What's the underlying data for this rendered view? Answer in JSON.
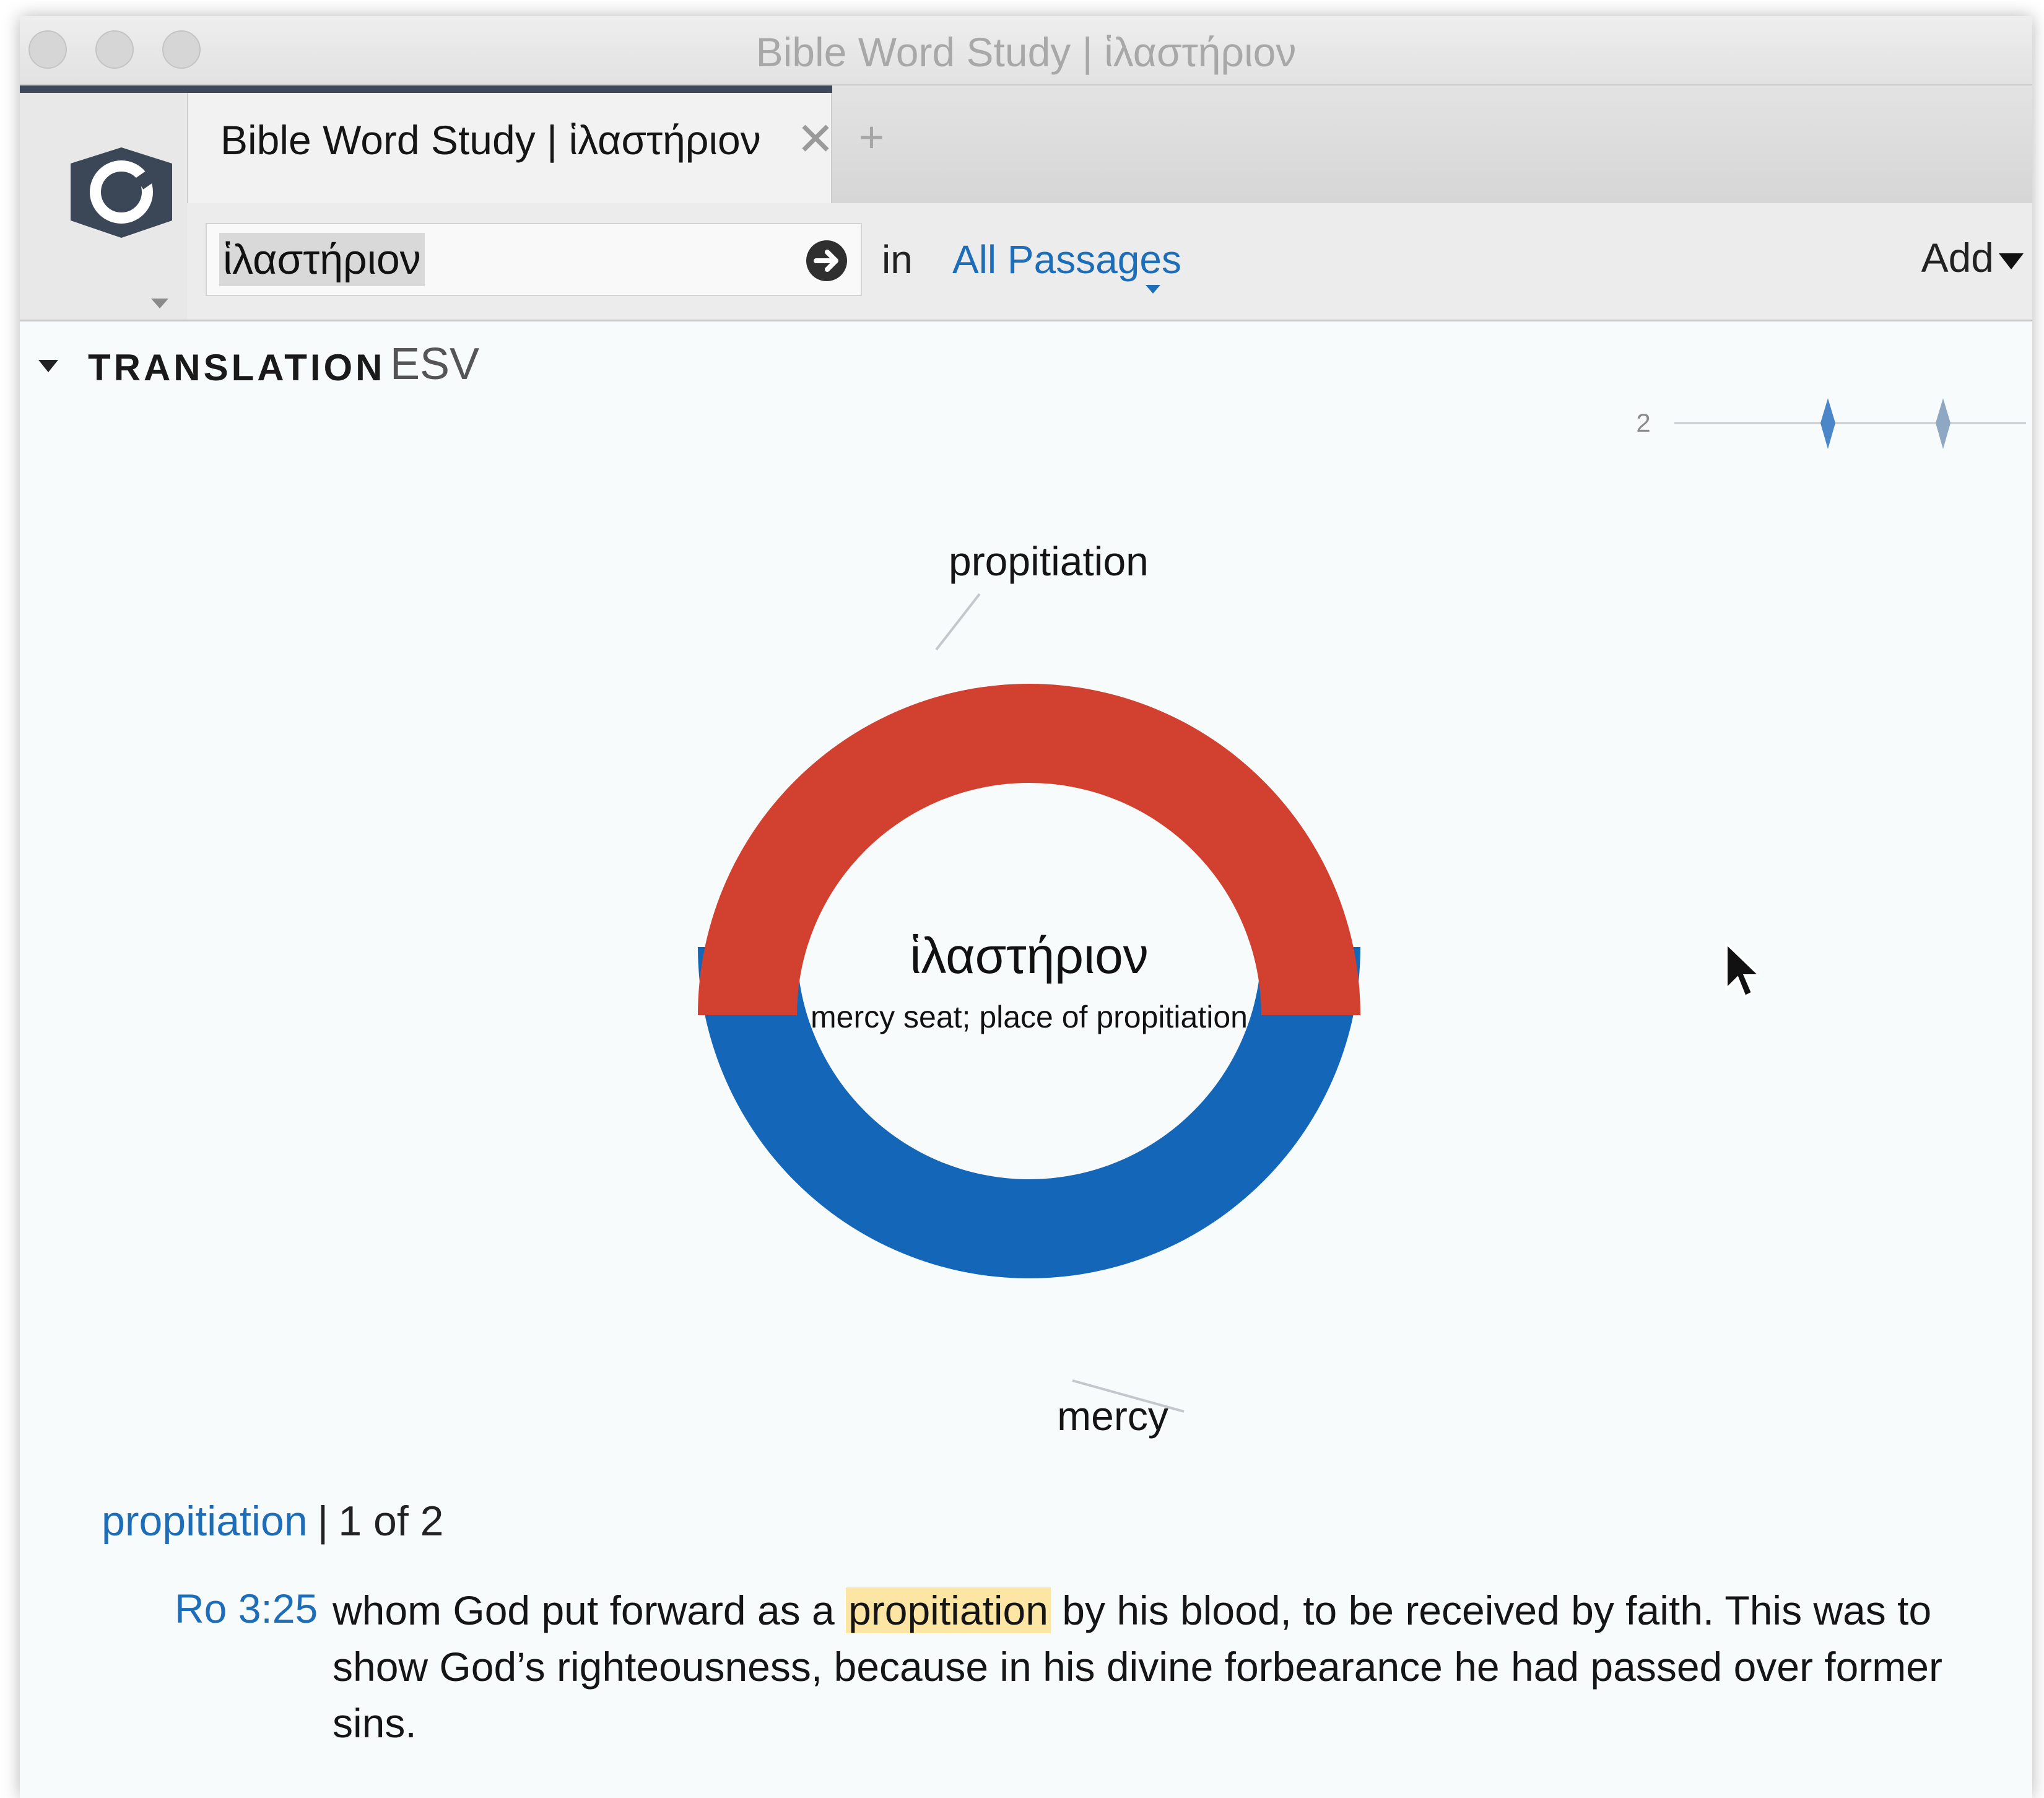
{
  "window": {
    "title": "Bible Word Study | ἱλαστήριον"
  },
  "tab": {
    "label": "Bible Word Study | ἱλαστήριον",
    "close_icon": "close-icon",
    "new_tab_icon": "plus-icon"
  },
  "toolbar": {
    "search_value": "ἱλαστήριον",
    "go_icon": "arrow-right-circle-icon",
    "in_label": "in",
    "passages_label": "All Passages",
    "add_label": "Add"
  },
  "section": {
    "title": "TRANSLATION",
    "version": "ESV",
    "minimap_count": "2"
  },
  "chart_data": {
    "type": "pie",
    "center_title": "ἱλαστήριον",
    "center_subtitle": "mercy seat; place of propitiation",
    "slices": [
      {
        "label": "propitiation",
        "value": 1,
        "color": "#1366b8"
      },
      {
        "label": "mercy",
        "value": 1,
        "color": "#d2412f"
      }
    ]
  },
  "results": {
    "word": "propitiation",
    "separator": "|",
    "count": "1 of 2",
    "verse_ref": "Ro 3:25",
    "verse_before": "whom God put forward as a ",
    "verse_highlight": "propitiation",
    "verse_after": " by his blood, to be received by faith. This was to show God’s righteousness, because in his divine forbearance he had passed over former sins."
  },
  "colors": {
    "accent": "#1e6db8",
    "highlight": "#fde6a4",
    "logo": "#3b4656"
  }
}
